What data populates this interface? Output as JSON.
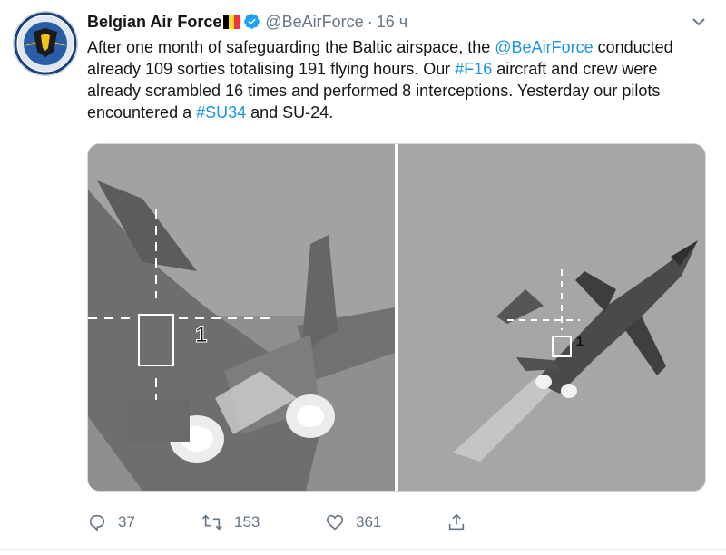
{
  "account": {
    "name": "Belgian Air Force",
    "handle": "@BeAirForce",
    "separator": "·",
    "time": "16 ч",
    "flag_colors": [
      "#000000",
      "#fdda24",
      "#ef3340"
    ],
    "verified_icon": "verified-badge-icon",
    "avatar_icon": "air-force-emblem-icon"
  },
  "tweet": {
    "t1": "After one month of safeguarding the Baltic airspace, the ",
    "m1": "@BeAirForce",
    "t2": " conducted already 109 sorties totalising 191 flying hours. Our ",
    "h1": "#F16",
    "t3": " aircraft and crew were already scrambled 16 times and performed 8 interceptions. Yesterday our pilots encountered a ",
    "h2": "#SU34",
    "t4": " and SU-24."
  },
  "media": {
    "photos": [
      {
        "label": "1",
        "icon": "jet-aircraft-icon"
      },
      {
        "label": "1",
        "icon": "jet-aircraft-icon"
      }
    ]
  },
  "actions": {
    "replies": "37",
    "retweets": "153",
    "likes": "361",
    "icons": [
      "reply-icon",
      "retweet-icon",
      "like-icon",
      "share-icon"
    ]
  },
  "colors": {
    "link": "#1b95e0",
    "secondary_text": "#657786",
    "verified": "#1da1f2"
  }
}
